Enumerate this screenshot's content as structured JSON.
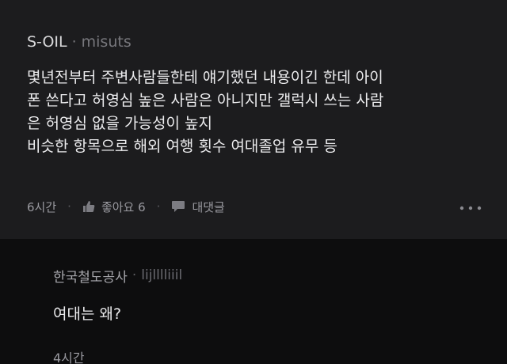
{
  "comment": {
    "author_company": "S-OIL",
    "separator": "·",
    "author_nick": "misuts",
    "body_lines": [
      "몇년전부터 주변사람들한테 얘기했던 내용이긴 한데 아이",
      "폰 쓴다고 허영심 높은 사람은 아니지만 갤럭시 쓰는 사람",
      "은 허영심 없을 가능성이 높지",
      "비슷한 항목으로 해외 여행 횟수 여대졸업 유무 등"
    ],
    "time": "6시간",
    "like_label": "좋아요 6",
    "reply_label": "대댓글",
    "icons": {
      "like": "thumbs-up-icon",
      "reply": "speech-bubble-icon",
      "more": "more-dots-icon"
    }
  },
  "reply": {
    "author_company": "한국철도공사",
    "separator": "·",
    "author_nick": "lijlllliiil",
    "text": "여대는 왜?",
    "time": "4시간"
  },
  "colors": {
    "comment_bg": "#1c1c1e",
    "reply_bg": "#0d0d0e",
    "text_primary": "#ececee",
    "text_muted": "#9a9aa0"
  }
}
